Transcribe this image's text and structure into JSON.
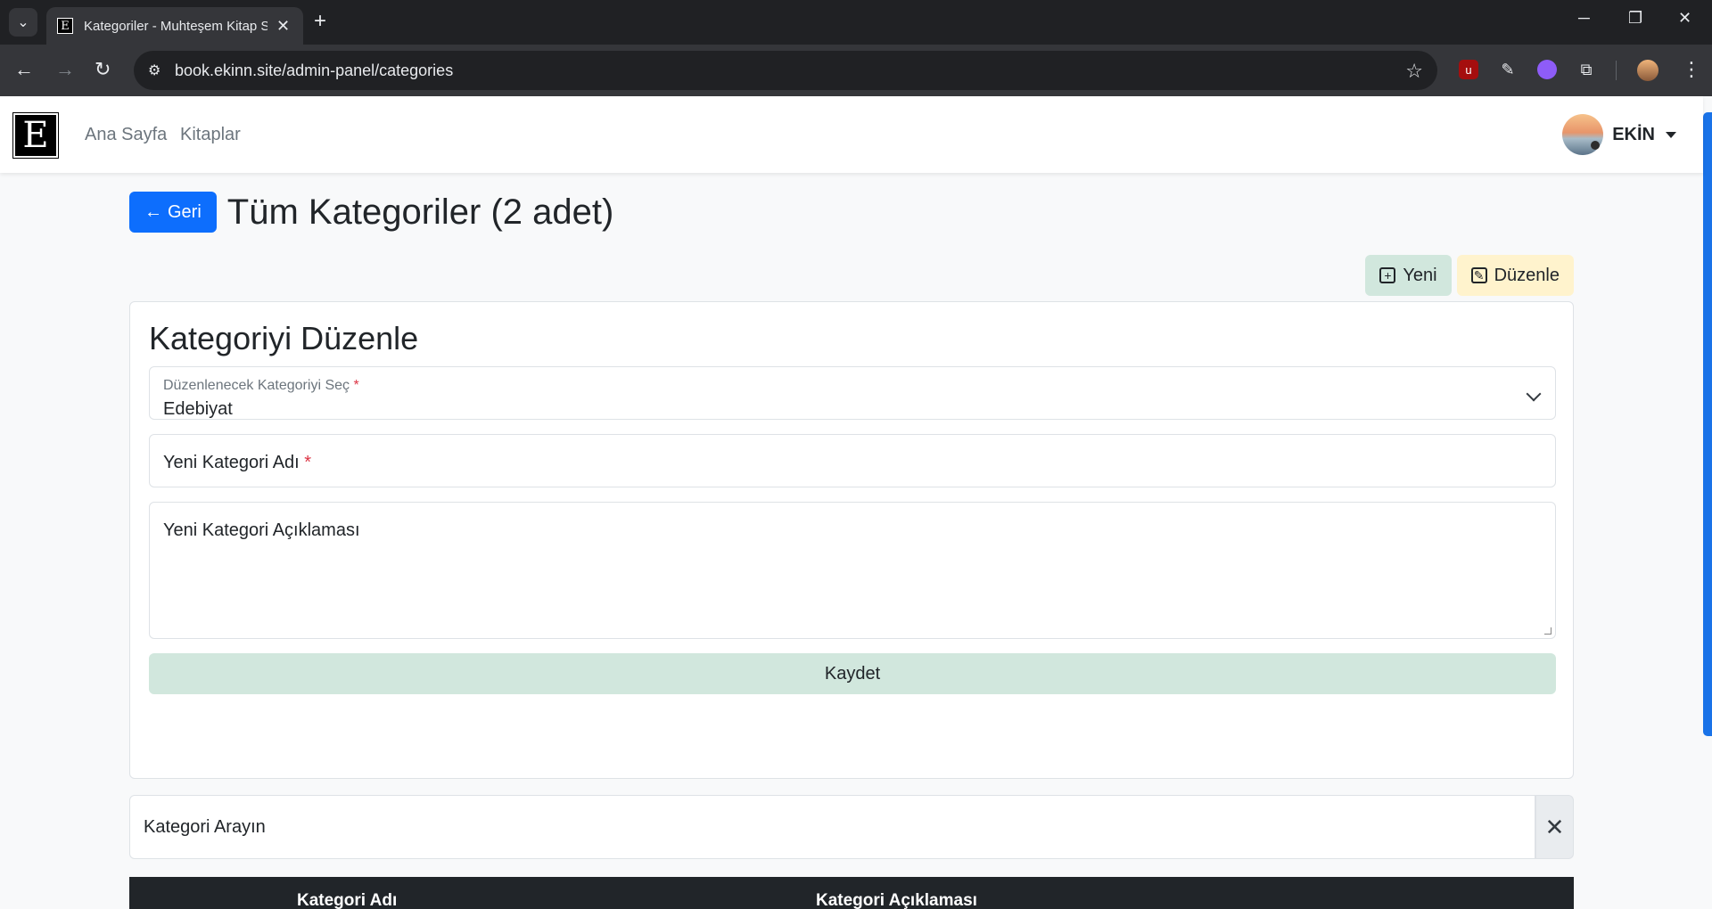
{
  "browser": {
    "tab_title": "Kategoriler - Muhteşem Kitap S",
    "tab_favicon": "E",
    "url": "book.ekinn.site/admin-panel/categories"
  },
  "navbar": {
    "brand": "E",
    "links": [
      "Ana Sayfa",
      "Kitaplar"
    ],
    "user_name": "EKİN"
  },
  "header": {
    "back_label": "Geri",
    "title": "Tüm Kategoriler (2 adet)"
  },
  "actions": {
    "new_label": "Yeni",
    "edit_label": "Düzenle"
  },
  "edit_form": {
    "title": "Kategoriyi Düzenle",
    "select_label": "Düzenlenecek Kategoriyi Seç",
    "select_value": "Edebiyat",
    "required_mark": "*",
    "name_label": "Yeni Kategori Adı",
    "description_label": "Yeni Kategori Açıklaması",
    "save_label": "Kaydet"
  },
  "search": {
    "placeholder": "Kategori Arayın"
  },
  "table": {
    "columns": [
      "Kategori Adı",
      "Kategori Açıklaması"
    ]
  },
  "colors": {
    "primary": "#0d6efd",
    "success_subtle": "#d1e7dd",
    "warning_subtle": "#fff3cd",
    "danger": "#dc3545",
    "table_dark": "#212529"
  },
  "icons": [
    "tab-search-icon",
    "close-icon",
    "plus-icon",
    "back-icon",
    "forward-icon",
    "reload-icon",
    "site-info-icon",
    "star-icon",
    "extension-icon",
    "kebab-menu-icon",
    "arrow-left-icon",
    "plus-square-icon",
    "pencil-square-icon",
    "chevron-down-icon",
    "caret-down-icon"
  ]
}
